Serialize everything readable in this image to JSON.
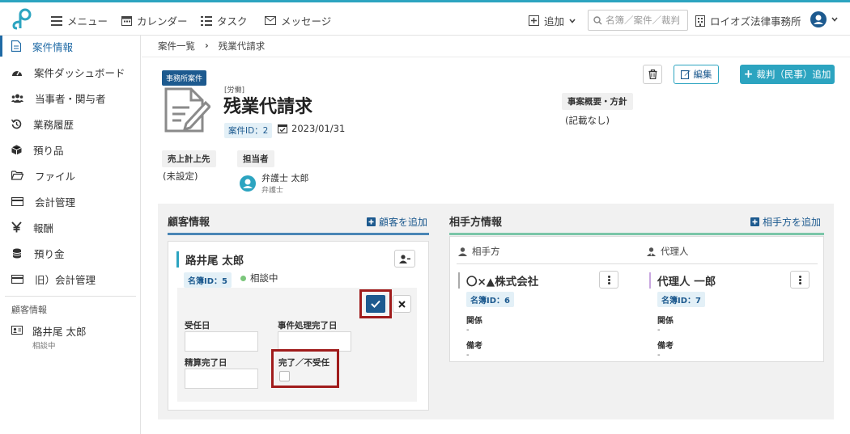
{
  "header": {
    "menu_label": "メニュー",
    "calendar_label": "カレンダー",
    "task_label": "タスク",
    "message_label": "メッセージ",
    "add_label": "追加",
    "search_placeholder": "名簿／案件／裁判",
    "office_name": "ロイオズ法律事務所"
  },
  "sidebar": {
    "items": [
      {
        "label": "案件情報",
        "icon": "document-icon"
      },
      {
        "label": "案件ダッシュボード",
        "icon": "dashboard-icon"
      },
      {
        "label": "当事者・関与者",
        "icon": "users-icon"
      },
      {
        "label": "業務履歴",
        "icon": "history-icon"
      },
      {
        "label": "預り品",
        "icon": "box-icon"
      },
      {
        "label": "ファイル",
        "icon": "folder-icon"
      },
      {
        "label": "会計管理",
        "icon": "card-icon"
      },
      {
        "label": "報酬",
        "icon": "yen-icon"
      },
      {
        "label": "預り金",
        "icon": "coins-icon"
      },
      {
        "label": "旧）会計管理",
        "icon": "card-icon"
      }
    ],
    "section_label": "顧客情報",
    "client": {
      "name": "路井尾 太郎",
      "status": "相談中"
    }
  },
  "breadcrumb": {
    "parent": "案件一覧",
    "sep": "›",
    "current": "残業代請求"
  },
  "case": {
    "badge": "事務所案件",
    "category": "[労働]",
    "title": "残業代請求",
    "id_label": "案件ID：2",
    "date": "2023/01/31",
    "summary_label": "事案概要・方針",
    "summary_value": "(記載なし)",
    "sales_label": "売上計上先",
    "sales_value": "(未設定)",
    "assignee_label": "担当者",
    "assignee_name": "弁護士 太郎",
    "assignee_role": "弁護士"
  },
  "actions": {
    "edit_label": "編集",
    "add_trial_label": "裁判（民事）追加"
  },
  "client_section": {
    "title": "顧客情報",
    "add_label": "顧客を追加",
    "card": {
      "name": "路井尾 太郎",
      "id_label": "名簿ID：5",
      "status": "相談中",
      "fields": {
        "accepted_date": "受任日",
        "case_done_date": "事件処理完了日",
        "settle_done_date": "精算完了日",
        "complete_label": "完了／不受任"
      }
    }
  },
  "opponent_section": {
    "title": "相手方情報",
    "add_label": "相手方を追加",
    "opponent_header": "相手方",
    "agent_header": "代理人",
    "opponent": {
      "name": "〇×▲株式会社",
      "id_label": "名簿ID：6",
      "relation_label": "関係",
      "relation_value": "-",
      "note_label": "備考",
      "note_value": "-"
    },
    "agent": {
      "name": "代理人 一郎",
      "id_label": "名簿ID：7",
      "relation_label": "関係",
      "relation_value": "-",
      "note_label": "備考",
      "note_value": "-"
    }
  },
  "colors": {
    "accent": "#2ca4c0",
    "navy": "#1d5a8f",
    "highlight": "#a01c1c",
    "confirm": "#1f6aa5"
  }
}
